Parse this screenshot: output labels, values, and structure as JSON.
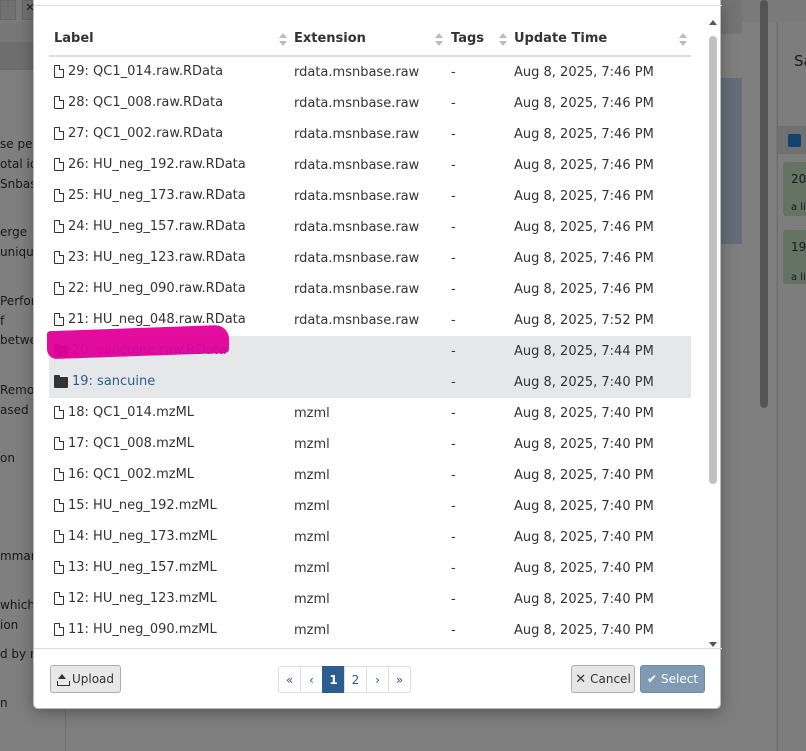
{
  "table": {
    "headers": {
      "label": "Label",
      "extension": "Extension",
      "tags": "Tags",
      "update_time": "Update Time"
    },
    "rows": [
      {
        "type": "file",
        "label": "29: QC1_014.raw.RData",
        "extension": "rdata.msnbase.raw",
        "tags": "-",
        "update_time": "Aug 8, 2025, 7:46 PM"
      },
      {
        "type": "file",
        "label": "28: QC1_008.raw.RData",
        "extension": "rdata.msnbase.raw",
        "tags": "-",
        "update_time": "Aug 8, 2025, 7:46 PM"
      },
      {
        "type": "file",
        "label": "27: QC1_002.raw.RData",
        "extension": "rdata.msnbase.raw",
        "tags": "-",
        "update_time": "Aug 8, 2025, 7:46 PM"
      },
      {
        "type": "file",
        "label": "26: HU_neg_192.raw.RData",
        "extension": "rdata.msnbase.raw",
        "tags": "-",
        "update_time": "Aug 8, 2025, 7:46 PM"
      },
      {
        "type": "file",
        "label": "25: HU_neg_173.raw.RData",
        "extension": "rdata.msnbase.raw",
        "tags": "-",
        "update_time": "Aug 8, 2025, 7:46 PM"
      },
      {
        "type": "file",
        "label": "24: HU_neg_157.raw.RData",
        "extension": "rdata.msnbase.raw",
        "tags": "-",
        "update_time": "Aug 8, 2025, 7:46 PM"
      },
      {
        "type": "file",
        "label": "23: HU_neg_123.raw.RData",
        "extension": "rdata.msnbase.raw",
        "tags": "-",
        "update_time": "Aug 8, 2025, 7:46 PM"
      },
      {
        "type": "file",
        "label": "22: HU_neg_090.raw.RData",
        "extension": "rdata.msnbase.raw",
        "tags": "-",
        "update_time": "Aug 8, 2025, 7:46 PM"
      },
      {
        "type": "file",
        "label": "21: HU_neg_048.raw.RData",
        "extension": "rdata.msnbase.raw",
        "tags": "-",
        "update_time": "Aug 8, 2025, 7:52 PM"
      },
      {
        "type": "folder",
        "label": "20: sancuine.raw.RData",
        "extension": "",
        "tags": "-",
        "update_time": "Aug 8, 2025, 7:44 PM"
      },
      {
        "type": "folder",
        "label": "19: sancuine",
        "extension": "",
        "tags": "-",
        "update_time": "Aug 8, 2025, 7:40 PM"
      },
      {
        "type": "file",
        "label": "18: QC1_014.mzML",
        "extension": "mzml",
        "tags": "-",
        "update_time": "Aug 8, 2025, 7:40 PM"
      },
      {
        "type": "file",
        "label": "17: QC1_008.mzML",
        "extension": "mzml",
        "tags": "-",
        "update_time": "Aug 8, 2025, 7:40 PM"
      },
      {
        "type": "file",
        "label": "16: QC1_002.mzML",
        "extension": "mzml",
        "tags": "-",
        "update_time": "Aug 8, 2025, 7:40 PM"
      },
      {
        "type": "file",
        "label": "15: HU_neg_192.mzML",
        "extension": "mzml",
        "tags": "-",
        "update_time": "Aug 8, 2025, 7:40 PM"
      },
      {
        "type": "file",
        "label": "14: HU_neg_173.mzML",
        "extension": "mzml",
        "tags": "-",
        "update_time": "Aug 8, 2025, 7:40 PM"
      },
      {
        "type": "file",
        "label": "13: HU_neg_157.mzML",
        "extension": "mzml",
        "tags": "-",
        "update_time": "Aug 8, 2025, 7:40 PM"
      },
      {
        "type": "file",
        "label": "12: HU_neg_123.mzML",
        "extension": "mzml",
        "tags": "-",
        "update_time": "Aug 8, 2025, 7:40 PM"
      },
      {
        "type": "file",
        "label": "11: HU_neg_090.mzML",
        "extension": "mzml",
        "tags": "-",
        "update_time": "Aug 8, 2025, 7:40 PM"
      }
    ]
  },
  "footer": {
    "upload_label": "Upload",
    "cancel_label": "Cancel",
    "select_label": "Select",
    "pagination": {
      "first": "«",
      "prev": "‹",
      "pages": [
        "1",
        "2"
      ],
      "current": "1",
      "next": "›",
      "last": "»"
    }
  },
  "background": {
    "tab_close": "✕",
    "left_text": [
      "se pea",
      "otal io",
      "Snbas",
      "erge",
      "uniqu",
      "Perfor",
      "f",
      "betwe",
      "Remo",
      "ased o",
      "on",
      "mmary",
      "which",
      "ion",
      "d by m",
      "n"
    ],
    "right_title": "Sa",
    "right_items": [
      "20",
      "a li",
      "19",
      "a li"
    ]
  },
  "icons": {
    "file": "file-icon",
    "folder": "folder-icon",
    "upload": "upload-icon",
    "cancel": "times-icon",
    "select": "check-icon"
  },
  "colors": {
    "link": "#2c5d8f",
    "folder_row_bg": "#e6e7e9",
    "highlight": "#e0009a",
    "select_button": "#7f9bb4"
  }
}
